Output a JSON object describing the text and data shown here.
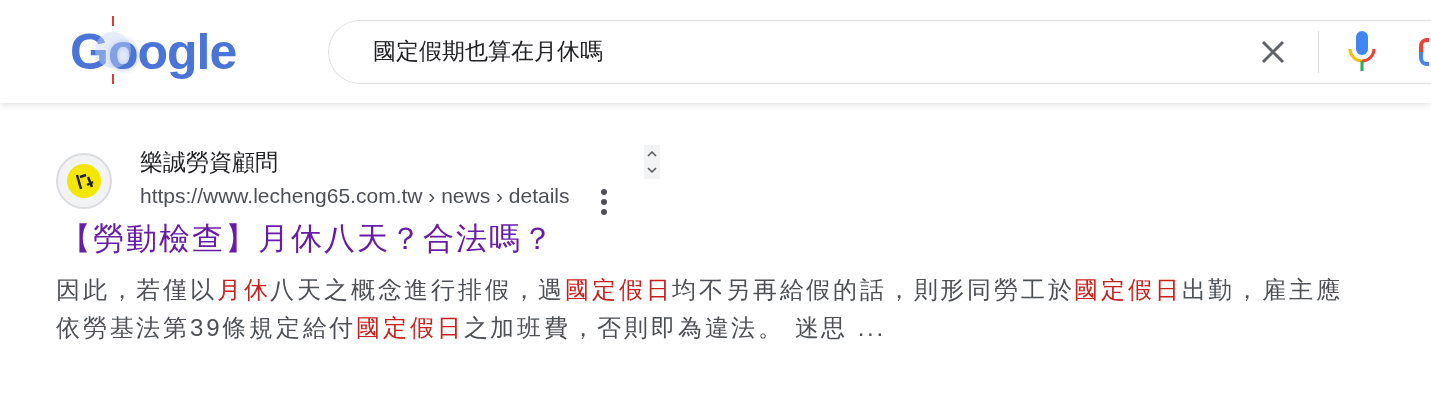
{
  "logo": {
    "letters": [
      "G",
      "o",
      "o",
      "g",
      "l",
      "e"
    ]
  },
  "search": {
    "value": "國定假期也算在月休嗎"
  },
  "result": {
    "site_name": "樂誠勞資顧問",
    "url": {
      "host": "https://www.lecheng65.com.tw",
      "path": [
        "news",
        "details"
      ],
      "separator": "›"
    },
    "title": "【勞動檢查】月休八天？合法嗎？",
    "snippet": [
      {
        "text": "因此，若僅以",
        "highlight": false
      },
      {
        "text": "月休",
        "highlight": true
      },
      {
        "text": "八天之概念進行排假，遇",
        "highlight": false
      },
      {
        "text": "國定假日",
        "highlight": true
      },
      {
        "text": "均不另再給假的話，則形同勞工於",
        "highlight": false
      },
      {
        "text": "國定假日",
        "highlight": true
      },
      {
        "text": "出勤，雇主應依勞基法第39條規定給付",
        "highlight": false
      },
      {
        "text": "國定假日",
        "highlight": true
      },
      {
        "text": "之加班費，否則即為違法。 迷思 ...",
        "highlight": false
      }
    ]
  }
}
